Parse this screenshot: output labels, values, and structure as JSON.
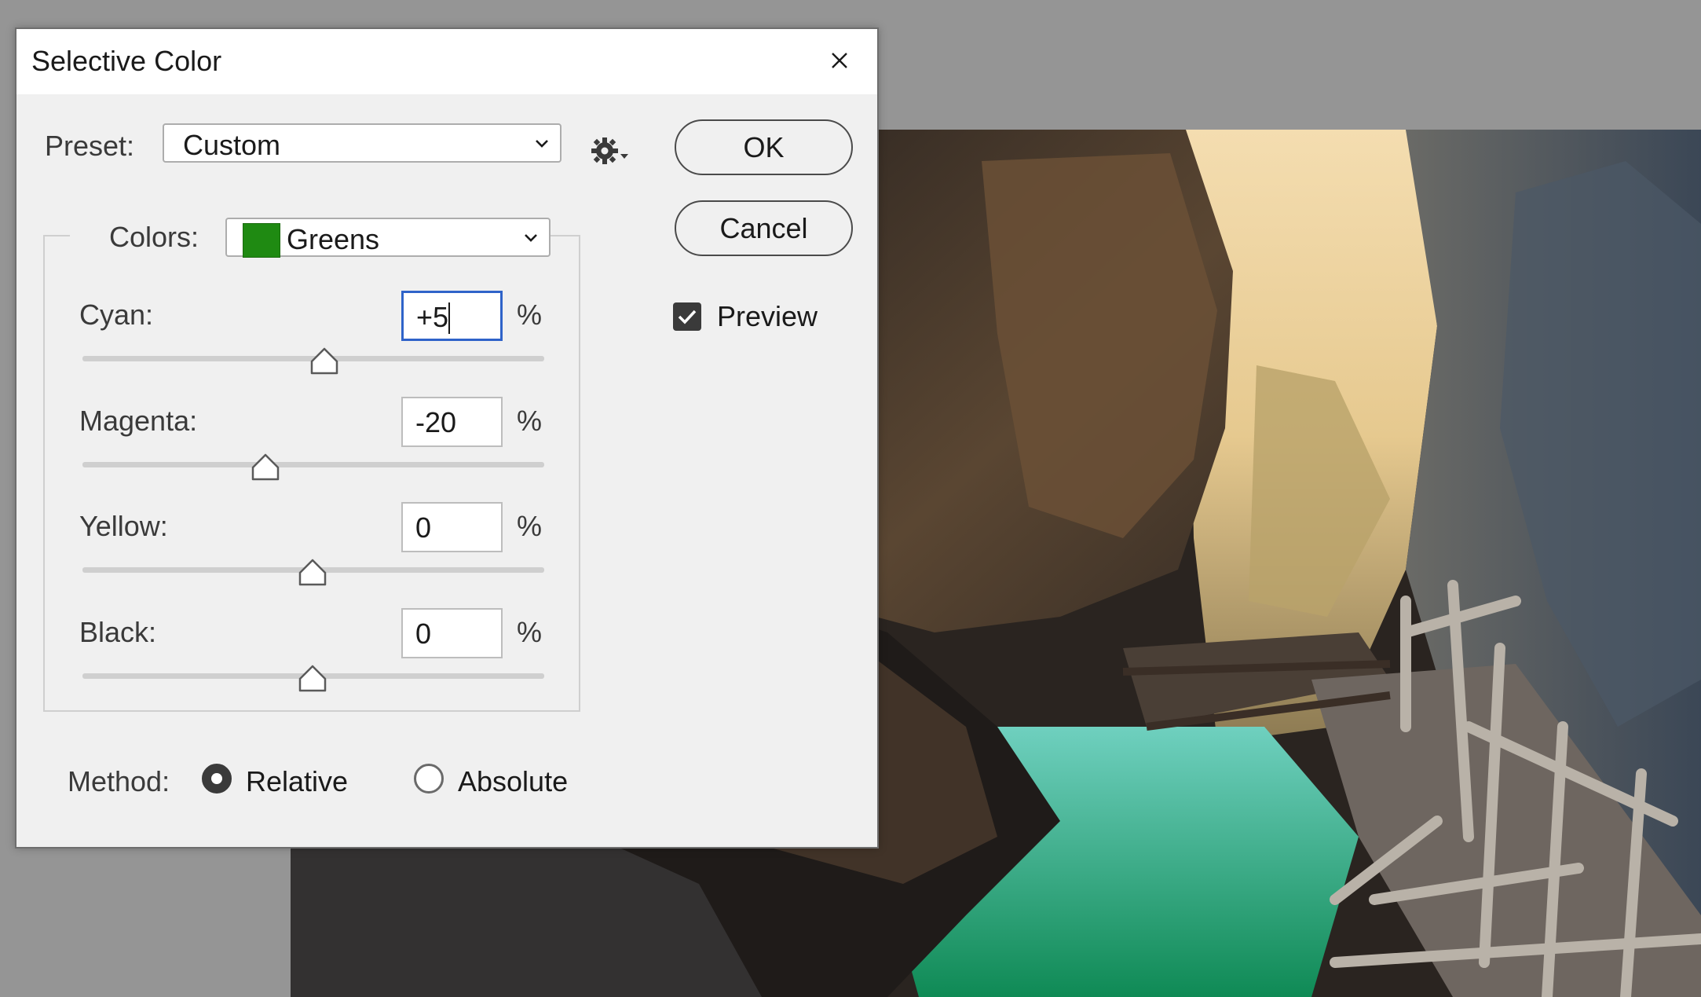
{
  "dialog": {
    "title": "Selective Color",
    "preset_label": "Preset:",
    "preset_value": "Custom",
    "ok_label": "OK",
    "cancel_label": "Cancel",
    "preview_label": "Preview",
    "preview_checked": true,
    "colors_label": "Colors:",
    "colors_value": "Greens",
    "colors_swatch": "#1f8a12",
    "percent_symbol": "%",
    "sliders": [
      {
        "label": "Cyan:",
        "value": "+5",
        "level": 5
      },
      {
        "label": "Magenta:",
        "value": "-20",
        "level": -20
      },
      {
        "label": "Yellow:",
        "value": "0",
        "level": 0
      },
      {
        "label": "Black:",
        "value": "0",
        "level": 0
      }
    ],
    "method_label": "Method:",
    "method_options": [
      "Relative",
      "Absolute"
    ],
    "method_selected": "Relative"
  },
  "colors": {
    "focus_border": "#2f63c9",
    "dialog_bg": "#f0f0f0",
    "workspace_bg": "#959595"
  },
  "icons": [
    "close-icon",
    "chevron-down-icon",
    "gear-icon",
    "checkmark-icon",
    "slider-thumb-icon"
  ]
}
